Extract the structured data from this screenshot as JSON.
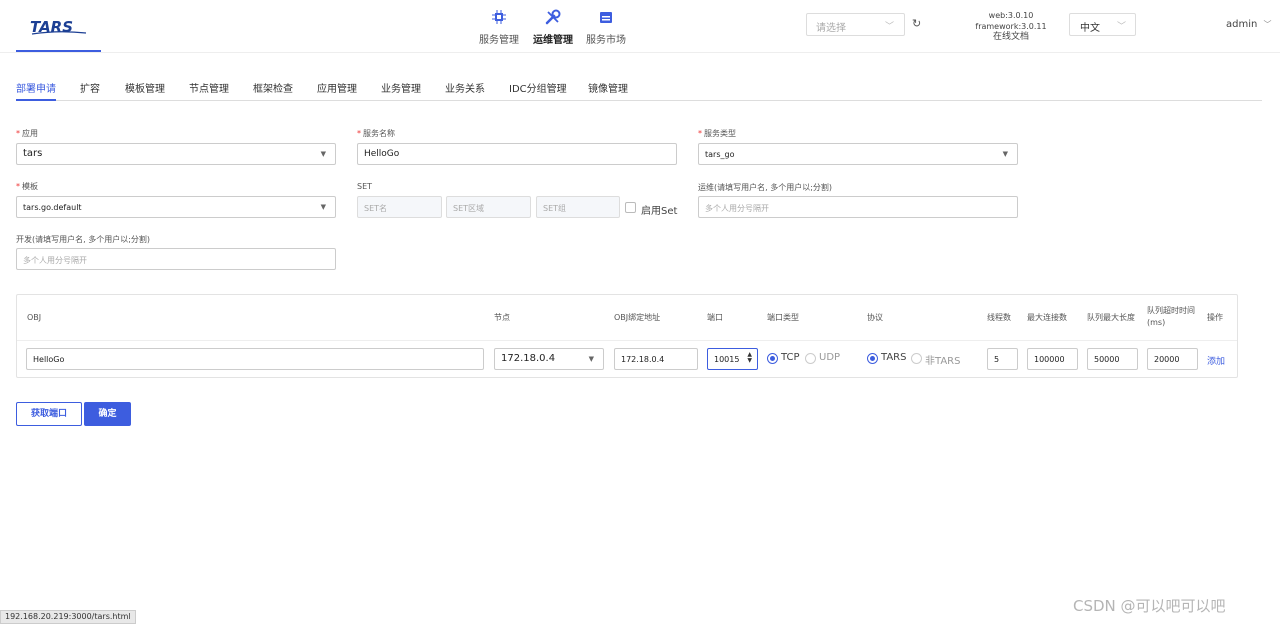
{
  "header": {
    "logo_text": "TARS",
    "nav": [
      {
        "label": "服务管理",
        "icon": "chip-icon"
      },
      {
        "label": "运维管理",
        "icon": "tools-icon",
        "active": true
      },
      {
        "label": "服务市场",
        "icon": "market-icon"
      }
    ],
    "select_placeholder": "请选择",
    "version": {
      "web": "web:3.0.10",
      "framework": "framework:3.0.11",
      "docs": "在线文档"
    },
    "language": "中文",
    "user": "admin"
  },
  "tabs": [
    "部署申请",
    "扩容",
    "模板管理",
    "节点管理",
    "框架检查",
    "应用管理",
    "业务管理",
    "业务关系",
    "IDC分组管理",
    "镜像管理"
  ],
  "form": {
    "app": {
      "label": "应用",
      "value": "tars"
    },
    "server_name": {
      "label": "服务名称",
      "value": "HelloGo"
    },
    "server_type": {
      "label": "服务类型",
      "value": "tars_go"
    },
    "template": {
      "label": "模板",
      "value": "tars.go.default"
    },
    "set": {
      "label": "SET",
      "name_ph": "SET名",
      "area_ph": "SET区域",
      "group_ph": "SET组",
      "enable_label": "启用Set"
    },
    "ops": {
      "label": "运维(请填写用户名, 多个用户以;分割)",
      "placeholder": "多个人用分号隔开"
    },
    "dev": {
      "label": "开发(请填写用户名, 多个用户以;分割)",
      "placeholder": "多个人用分号隔开"
    }
  },
  "table": {
    "headers": {
      "obj": "OBJ",
      "node": "节点",
      "bind": "OBJ绑定地址",
      "port": "端口",
      "port_type": "端口类型",
      "protocol": "协议",
      "threads": "线程数",
      "max_conn": "最大连接数",
      "queue_len": "队列最大长度",
      "queue_timeout": "队列超时时间",
      "queue_timeout_unit": "(ms)",
      "action": "操作"
    },
    "row": {
      "obj": "HelloGo",
      "node": "172.18.0.4",
      "bind": "172.18.0.4",
      "port": "10015",
      "port_types": [
        "TCP",
        "UDP"
      ],
      "protocols": [
        "TARS",
        "非TARS"
      ],
      "threads": "5",
      "max_conn": "100000",
      "queue_len": "50000",
      "queue_timeout": "20000",
      "action": "添加"
    }
  },
  "buttons": {
    "get_port": "获取端口",
    "confirm": "确定"
  },
  "status_url": "192.168.20.219:3000/tars.html",
  "watermark": "CSDN @可以吧可以吧",
  "colors": {
    "accent": "#3d5ddf",
    "required": "#e33333"
  }
}
